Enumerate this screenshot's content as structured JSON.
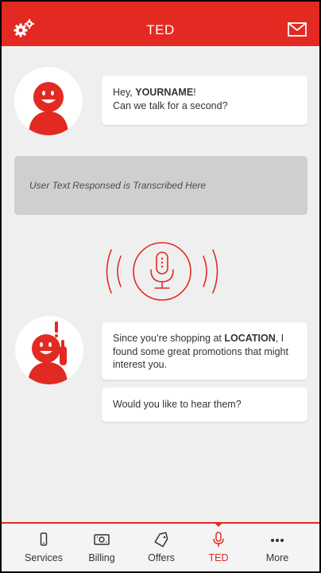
{
  "header": {
    "title": "TED",
    "settings_icon": "gears-icon",
    "mail_icon": "envelope-icon",
    "color": "#e22a22"
  },
  "messages": [
    {
      "pre": "Hey, ",
      "bold": "YOURNAME",
      "post": "!",
      "line2": "Can we talk for a second?"
    },
    {
      "pre": "Since you’re shopping at ",
      "bold": "LOCATION",
      "post": ",  I found some great promotions that might interest you."
    },
    {
      "text": "Would you like to hear them?"
    }
  ],
  "transcript": {
    "text": "User Text Responsed is Transcribed Here"
  },
  "tabs": [
    {
      "label": "Services",
      "icon": "phone-icon"
    },
    {
      "label": "Billing",
      "icon": "bill-icon"
    },
    {
      "label": "Offers",
      "icon": "tag-icon"
    },
    {
      "label": "TED",
      "icon": "microphone-icon",
      "active": true
    },
    {
      "label": "More",
      "icon": "more-dots-icon"
    }
  ]
}
